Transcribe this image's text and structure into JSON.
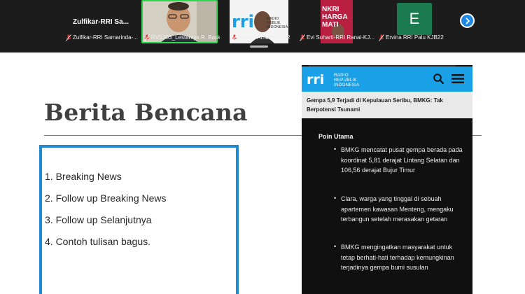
{
  "conference": {
    "first_tile_title": "Zulfikar-RRI  Sa...",
    "participants": [
      {
        "name": "Zulfikar-RRI Samarinda-..."
      },
      {
        "name": "RVS303_Lestantya R. Basko..."
      },
      {
        "name": "Rainer-Ambon-KJB22"
      },
      {
        "name": "Evi Suharti-RRI Ranai-KJ..."
      },
      {
        "name": "Ervina RRI Palu KJB22"
      }
    ],
    "avatar_letter": "E",
    "tile_fragments": {
      "rri_small_1": "RADIO",
      "rri_small_2": "PUBLIK",
      "rri_small_3": "INDONESIA",
      "banner_line1": "NKRI",
      "banner_line2": "HARGA",
      "banner_line3": "MATI"
    },
    "colors": {
      "active_speaker": "#2fd84e",
      "next_button": "#1e88e5",
      "muted_mic": "#e53935"
    }
  },
  "slide": {
    "title": "Berita Bencana",
    "items": [
      "1. Breaking News",
      "2. Follow up Breaking News",
      "3. Follow up Selanjutnya",
      "4. Contoh tulisan bagus."
    ],
    "box_color": "#1f8ad0"
  },
  "phone": {
    "brand_line1": "RADIO",
    "brand_line2": "REPUBLIK",
    "brand_line3": "INDONESIA",
    "headline": "Gempa 5,9 Terjadi di Kepulauan Seribu, BMKG: Tak Berpotensi Tsunami",
    "section_title": "Poin Utama",
    "points": [
      "BMKG mencatat pusat gempa berada pada koordinat 5,81 derajat Lintang Selatan dan 106,56 derajat Bujur Timur",
      "Clara, warga yang tinggal di sebuah apartemen kawasan Menteng, mengaku terbangun setelah merasakan getaran",
      "BMKG mengingatkan masyarakat untuk tetap berhati-hati terhadap kemungkinan terjadinya gempa bumi susulan"
    ],
    "header_color": "#1aa0e6"
  }
}
